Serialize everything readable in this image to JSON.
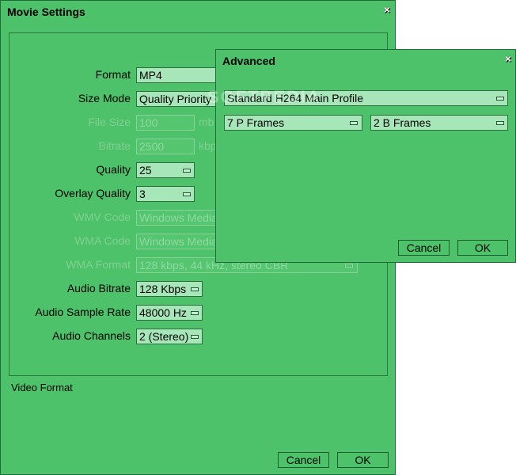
{
  "main": {
    "title": "Movie Settings",
    "rows": [
      {
        "label": "Format",
        "value": "MP4",
        "unit": "",
        "disabled": false
      },
      {
        "label": "Size Mode",
        "value": "Quality Priority",
        "unit": "",
        "disabled": false
      },
      {
        "label": "File Size",
        "value": "100",
        "unit": "mb",
        "disabled": true
      },
      {
        "label": "Bitrate",
        "value": "2500",
        "unit": "kbp",
        "disabled": true
      },
      {
        "label": "Quality",
        "value": "25",
        "unit": "",
        "disabled": false
      },
      {
        "label": "Overlay Quality",
        "value": "3",
        "unit": "",
        "disabled": false
      },
      {
        "label": "WMV Code",
        "value": "Windows Media",
        "unit": "",
        "disabled": true
      },
      {
        "label": "WMA Code",
        "value": "Windows Media",
        "unit": "",
        "disabled": true
      },
      {
        "label": "WMA Format",
        "value": "128 kbps, 44 kHz, stereo CBR",
        "unit": "",
        "disabled": true
      },
      {
        "label": "Audio Bitrate",
        "value": "128 Kbps",
        "unit": "",
        "disabled": false
      },
      {
        "label": "Audio Sample Rate",
        "value": "48000 Hz",
        "unit": "",
        "disabled": false
      },
      {
        "label": "Audio Channels",
        "value": "2 (Stereo)",
        "unit": "",
        "disabled": false
      }
    ],
    "status_text": "Video Format",
    "cancel_label": "Cancel",
    "ok_label": "OK",
    "close_glyph": "×"
  },
  "advanced": {
    "title": "Advanced",
    "profile": "Standard H264 Main Profile",
    "p_frames": "7 P Frames",
    "b_frames": "2 B Frames",
    "cancel_label": "Cancel",
    "ok_label": "OK",
    "close_glyph": "×"
  },
  "watermark": "SOFTPEDIA",
  "colors": {
    "dialog_bg": "#4dc26a",
    "field_bg": "#a7e6b9",
    "disabled_text": "#8fd9a2"
  }
}
